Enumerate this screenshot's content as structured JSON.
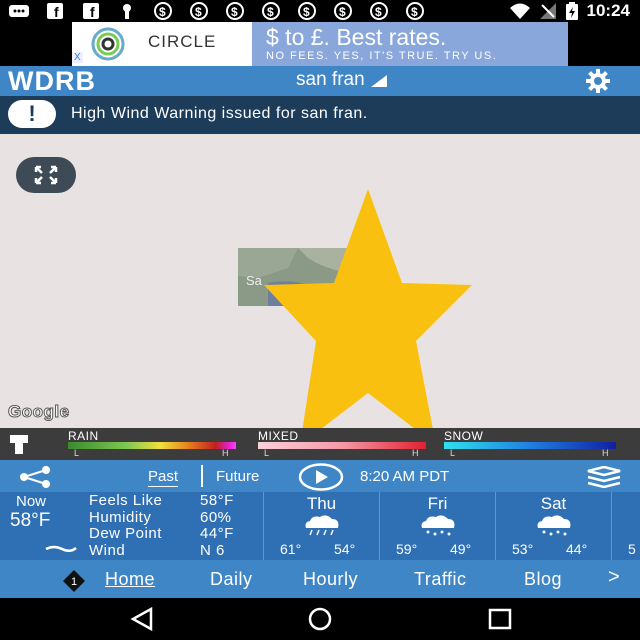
{
  "status_bar": {
    "time": "10:24"
  },
  "ad": {
    "logo_text": "CIRCLE",
    "headline": "$ to £. Best rates.",
    "subline": "NO FEES. YES, IT'S TRUE. TRY US.",
    "close_label": "X"
  },
  "header": {
    "logo": "WDRB",
    "location": "san fran"
  },
  "alert": {
    "icon": "!",
    "text": "High Wind Warning issued for san fran."
  },
  "map": {
    "thumbnail_label": "Sa",
    "attribution": "Google"
  },
  "legend": {
    "rain": {
      "title": "RAIN",
      "low": "L",
      "high": "H"
    },
    "mixed": {
      "title": "MIXED",
      "low": "L",
      "high": "H"
    },
    "snow": {
      "title": "SNOW",
      "low": "L",
      "high": "H"
    }
  },
  "timeline": {
    "past_label": "Past",
    "future_label": "Future",
    "time": "8:20 AM PDT"
  },
  "current": {
    "now_label": "Now",
    "temp": "58°F",
    "feels_like_label": "Feels Like",
    "feels_like": "58°F",
    "humidity_label": "Humidity",
    "humidity": "60%",
    "dew_point_label": "Dew Point",
    "dew_point": "44°F",
    "wind_label": "Wind",
    "wind": "N 6"
  },
  "forecast": [
    {
      "day": "Thu",
      "hi": "61°",
      "lo": "54°"
    },
    {
      "day": "Fri",
      "hi": "59°",
      "lo": "49°"
    },
    {
      "day": "Sat",
      "hi": "53°",
      "lo": "44°"
    },
    {
      "day": "",
      "hi": "5",
      "lo": ""
    }
  ],
  "nav": {
    "badge": "1",
    "items": [
      "Home",
      "Daily",
      "Hourly",
      "Traffic",
      "Blog"
    ],
    "more": ">"
  },
  "colors": {
    "app_blue": "#3f86c6",
    "alert_navy": "#1c3c5a",
    "star": "#f9c00f"
  }
}
